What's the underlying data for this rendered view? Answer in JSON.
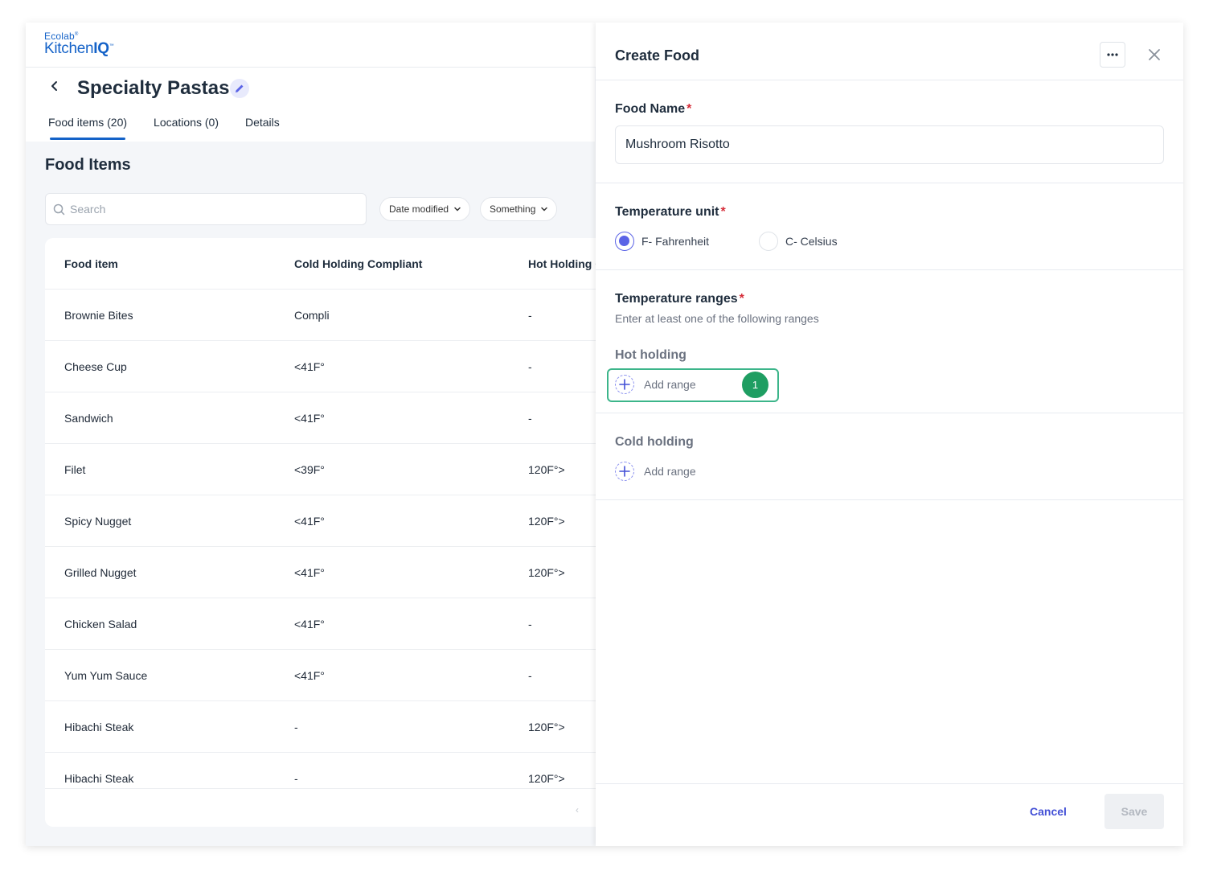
{
  "brand": {
    "line1": "Ecolab",
    "line2_light": "Kitchen",
    "line2_bold": "IQ"
  },
  "page": {
    "title": "Specialty Pastas"
  },
  "tabs": [
    {
      "label": "Food items (20)",
      "active": true
    },
    {
      "label": "Locations (0)",
      "active": false
    },
    {
      "label": "Details",
      "active": false
    }
  ],
  "food_items": {
    "title": "Food Items",
    "search_placeholder": "Search",
    "filters": [
      "Date modified",
      "Something"
    ],
    "columns": [
      "Food item",
      "Cold Holding Compliant",
      "Hot Holding C"
    ],
    "rows": [
      [
        "Brownie Bites",
        "Compli",
        "-"
      ],
      [
        "Cheese Cup",
        "<41F°",
        "-"
      ],
      [
        "Sandwich",
        "<41F°",
        "-"
      ],
      [
        "Filet",
        "<39F°",
        "120F°>"
      ],
      [
        "Spicy Nugget",
        "<41F°",
        "120F°>"
      ],
      [
        "Grilled Nugget",
        "<41F°",
        "120F°>"
      ],
      [
        "Chicken Salad",
        "<41F°",
        "-"
      ],
      [
        "Yum Yum Sauce",
        "<41F°",
        "-"
      ],
      [
        "Hibachi Steak",
        "-",
        "120F°>"
      ],
      [
        "Hibachi Steak",
        "-",
        "120F°>"
      ]
    ]
  },
  "drawer": {
    "title": "Create Food",
    "food_name": {
      "label": "Food Name",
      "required": "*",
      "value": "Mushroom Risotto"
    },
    "temperature_unit": {
      "label": "Temperature unit",
      "required": "*",
      "options": [
        {
          "label": "F- Fahrenheit",
          "selected": true
        },
        {
          "label": "C- Celsius",
          "selected": false
        }
      ]
    },
    "temperature_ranges": {
      "label": "Temperature ranges",
      "required": "*",
      "hint": "Enter at least one of the following ranges",
      "hot_holding": {
        "label": "Hot holding",
        "add_label": "Add range"
      },
      "cold_holding": {
        "label": "Cold holding",
        "add_label": "Add range"
      },
      "step_badge": "1"
    },
    "footer": {
      "cancel": "Cancel",
      "save": "Save"
    }
  },
  "colors": {
    "accent": "#4350d6",
    "brand": "#1462c8",
    "highlight": "#3cb58a",
    "badge": "#1f9e62",
    "required": "#d62e3a"
  },
  "icons": [
    "back-arrow-icon",
    "pencil-icon",
    "search-icon",
    "chevron-down-icon",
    "more-horizontal-icon",
    "close-icon",
    "plus-icon",
    "chevron-left-icon"
  ]
}
